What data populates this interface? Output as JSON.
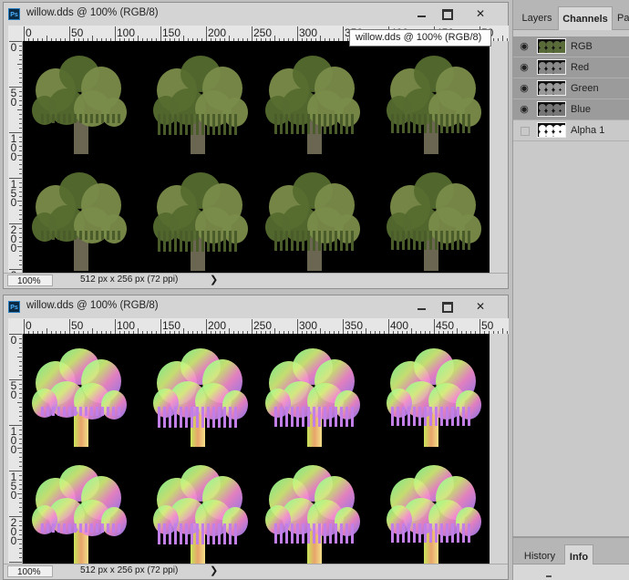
{
  "documents": [
    {
      "title": "willow.dds @ 100% (RGB/8)",
      "zoom": "100%",
      "info": "512 px x 256 px (72 ppi)",
      "variant": "diffuse"
    },
    {
      "title": "willow.dds @ 100% (RGB/8)",
      "zoom": "100%",
      "info": "512 px x 256 px (72 ppi)",
      "variant": "normal"
    }
  ],
  "ruler": {
    "top_labels": [
      "0",
      "50",
      "100",
      "150",
      "200",
      "250",
      "300",
      "350",
      "400",
      "450",
      "50"
    ],
    "left_labels": [
      "0",
      "50",
      "100",
      "150",
      "200",
      "25"
    ]
  },
  "tooltip": "willow.dds @ 100% (RGB/8)",
  "status_arrow": "❯",
  "window_controls": {
    "close": "✕"
  },
  "panel": {
    "tabs": [
      "Layers",
      "Channels",
      "Pa"
    ],
    "active_tab": "Channels",
    "channels": [
      {
        "name": "RGB",
        "visible": true,
        "thumb": "rgb"
      },
      {
        "name": "Red",
        "visible": true,
        "thumb": "gray"
      },
      {
        "name": "Green",
        "visible": true,
        "thumb": "gray"
      },
      {
        "name": "Blue",
        "visible": true,
        "thumb": "gray"
      },
      {
        "name": "Alpha 1",
        "visible": false,
        "thumb": "alpha"
      }
    ],
    "bottom_tabs": [
      "History",
      "Info"
    ],
    "bottom_active": "Info"
  },
  "colors": {
    "foliage": "#556b2f",
    "foliage_light": "#7a8c4a",
    "trunk": "#6b6651",
    "canvas_bg": "#000000",
    "selected_channel": "#9b9b9b"
  }
}
